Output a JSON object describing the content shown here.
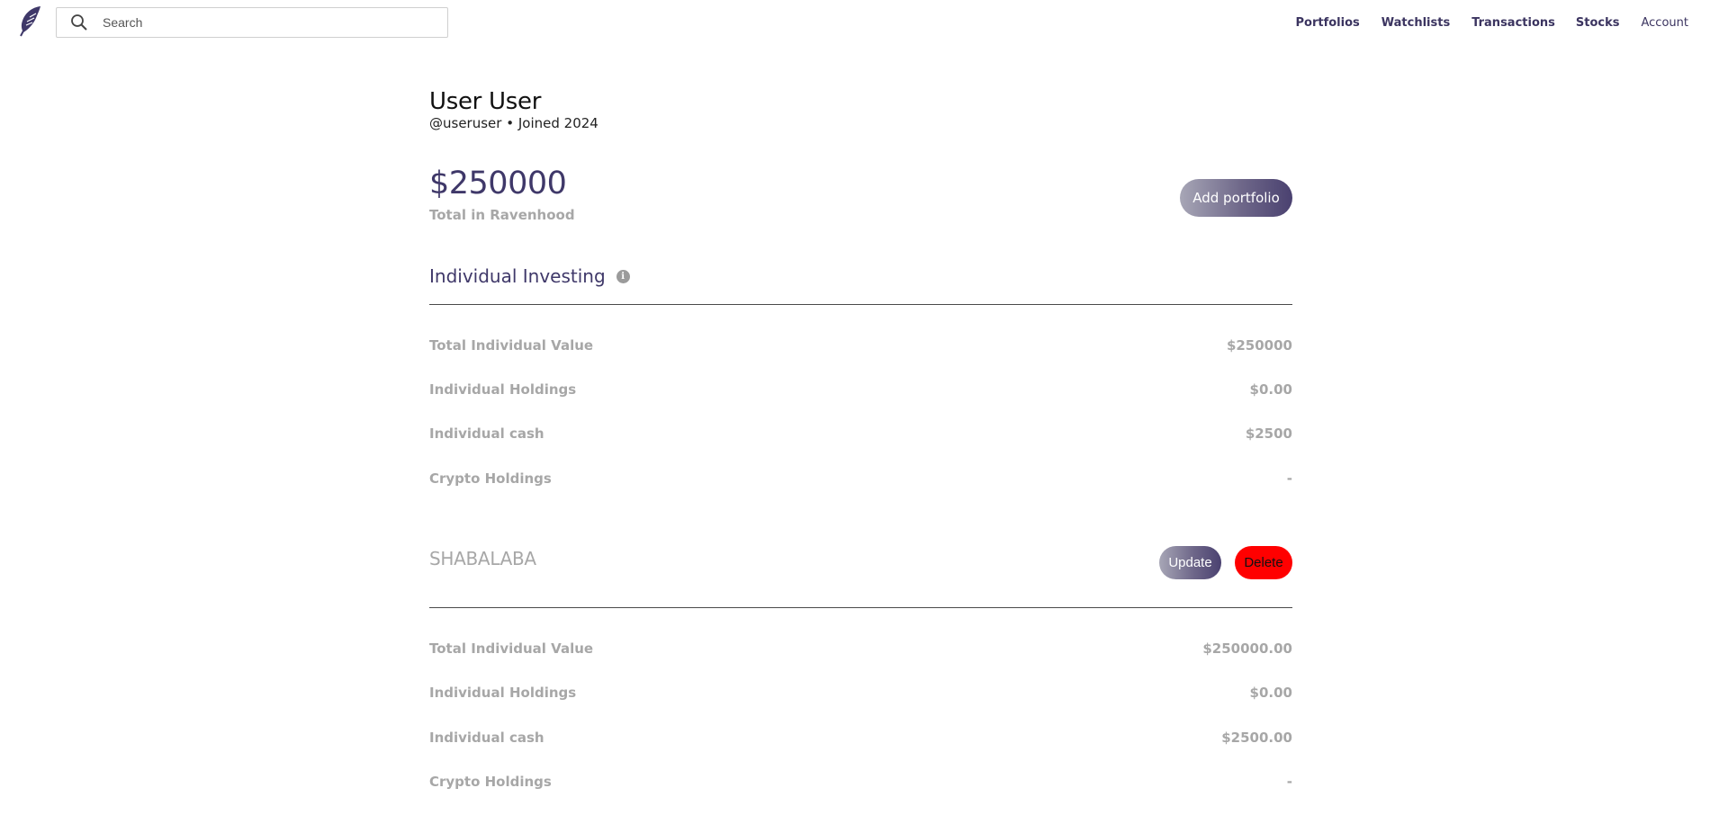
{
  "header": {
    "logo": "feather-logo-icon",
    "search": {
      "placeholder": "Search",
      "value": ""
    },
    "nav": [
      "Portfolios",
      "Watchlists",
      "Transactions",
      "Stocks",
      "Account"
    ]
  },
  "profile": {
    "name": "User User",
    "handle": "@useruser",
    "separator": "•",
    "joined": "Joined 2024"
  },
  "summary": {
    "total_value": "$250000",
    "total_label": "Total in Ravenhood",
    "add_portfolio_label": "Add portfolio"
  },
  "individual": {
    "title": "Individual Investing",
    "info_icon": "i",
    "rows": [
      {
        "label": "Total Individual Value",
        "value": "$250000"
      },
      {
        "label": "Individual Holdings",
        "value": "$0.00"
      },
      {
        "label": "Individual cash",
        "value": "$2500"
      },
      {
        "label": "Crypto Holdings",
        "value": "-"
      }
    ]
  },
  "portfolio": {
    "title": "SHABALABA",
    "update_label": "Update",
    "delete_label": "Delete",
    "rows": [
      {
        "label": "Total Individual Value",
        "value": "$250000.00"
      },
      {
        "label": "Individual Holdings",
        "value": "$0.00"
      },
      {
        "label": "Individual cash",
        "value": "$2500.00"
      },
      {
        "label": "Crypto Holdings",
        "value": "-"
      }
    ]
  },
  "colors": {
    "accent": "#3f3869",
    "muted": "#a7a7a7",
    "delete": "#ff0000"
  }
}
